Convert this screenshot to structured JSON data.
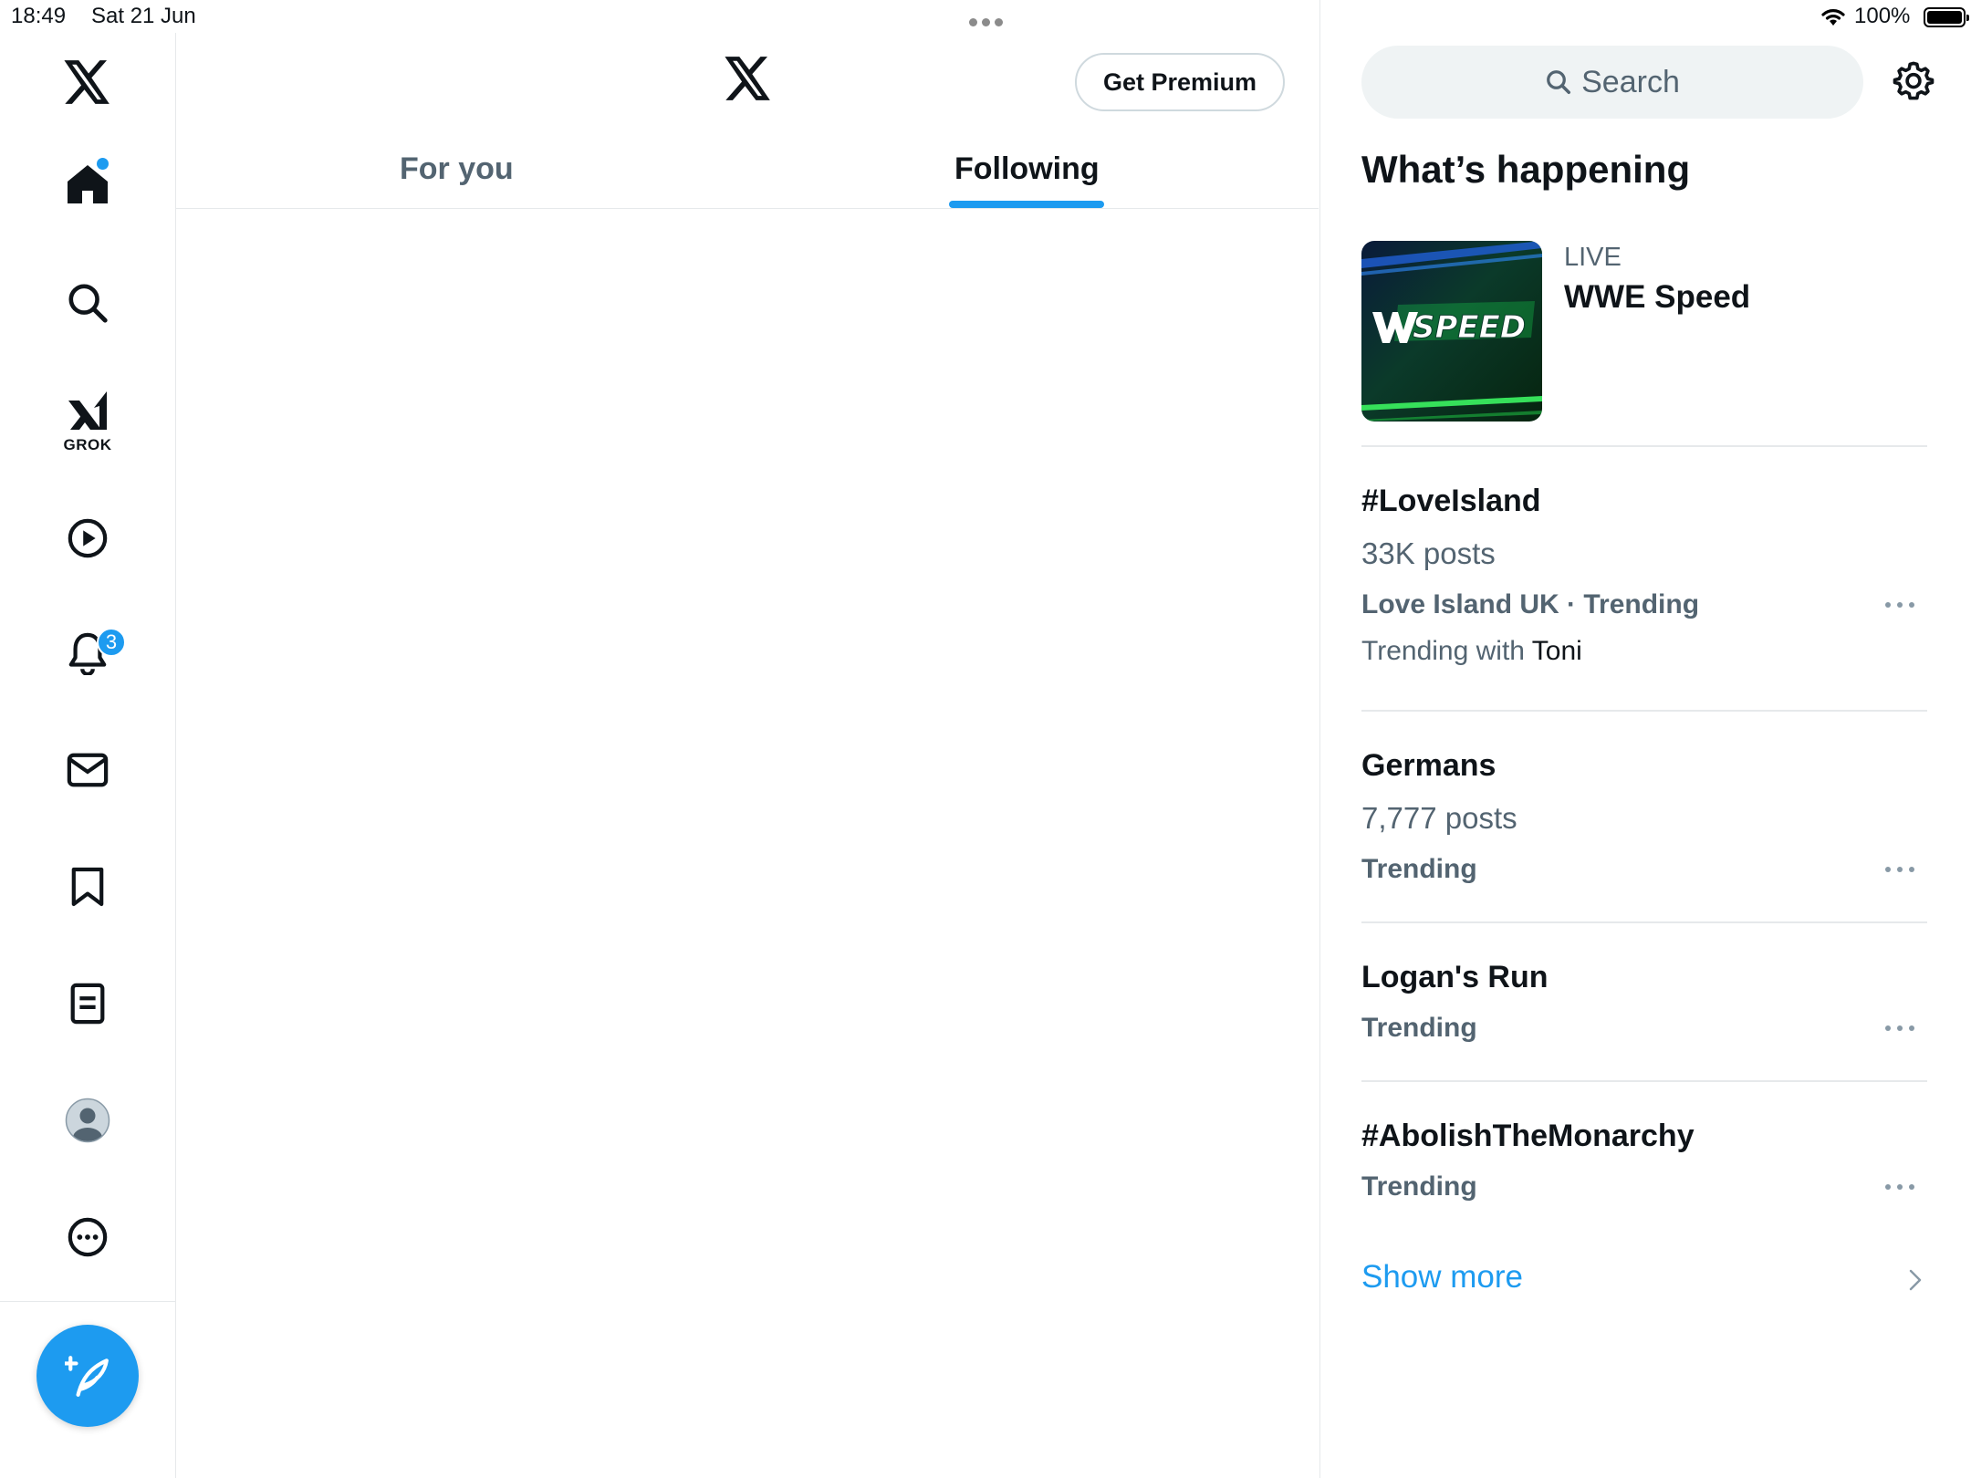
{
  "status_bar": {
    "time": "18:49",
    "date": "Sat 21 Jun",
    "battery": "100%"
  },
  "nav": {
    "items": [
      {
        "name": "x-logo-icon"
      },
      {
        "name": "home-icon",
        "has_dot": true
      },
      {
        "name": "search-icon"
      },
      {
        "name": "grok-icon",
        "label": "GROK"
      },
      {
        "name": "video-play-icon"
      },
      {
        "name": "bell-icon",
        "badge": "3"
      },
      {
        "name": "mail-icon"
      },
      {
        "name": "bookmark-icon"
      },
      {
        "name": "article-icon"
      },
      {
        "name": "avatar-icon"
      },
      {
        "name": "more-icon"
      }
    ],
    "compose_icon": "feather-plus-icon"
  },
  "header": {
    "premium_label": "Get Premium",
    "tabs": [
      {
        "label": "For you",
        "active": false
      },
      {
        "label": "Following",
        "active": true
      }
    ]
  },
  "sidebar": {
    "search_placeholder": "Search",
    "section_title": "What’s happening",
    "live": {
      "tag": "LIVE",
      "title": "WWE Speed",
      "thumb_text": "SPEED"
    },
    "trends": [
      {
        "title": "#LoveIsland",
        "posts": "33K posts",
        "meta": "Love Island UK · Trending",
        "with_prefix": "Trending with",
        "with_name": "Toni"
      },
      {
        "title": "Germans",
        "posts": "7,777 posts",
        "meta": "Trending"
      },
      {
        "title": "Logan's Run",
        "meta": "Trending"
      },
      {
        "title": "#AbolishTheMonarchy",
        "meta": "Trending"
      }
    ],
    "show_more": "Show more"
  },
  "colors": {
    "accent": "#1d9bf0",
    "text_primary": "#0f1419",
    "text_secondary": "#536471",
    "divider": "#e6e9eb"
  }
}
